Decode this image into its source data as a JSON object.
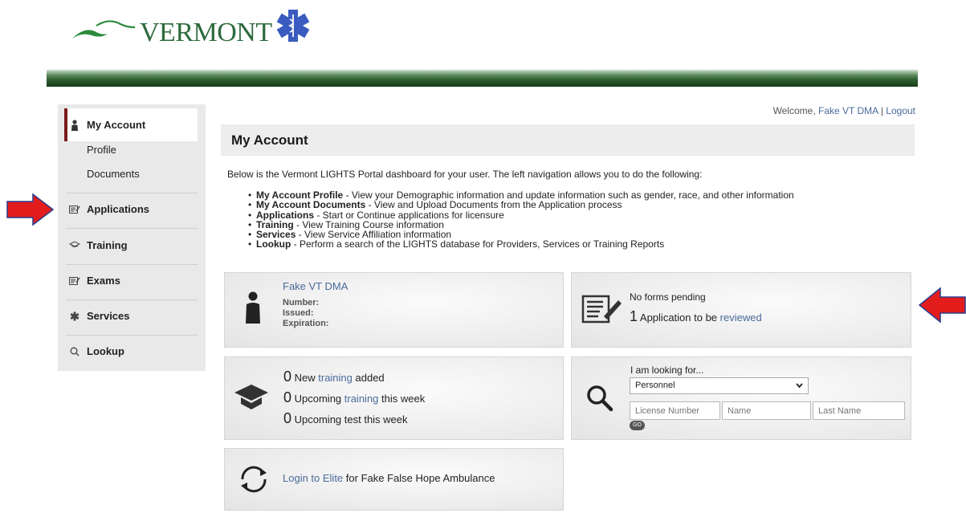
{
  "header": {
    "logo_text": "VERMONT"
  },
  "welcome": {
    "prefix": "Welcome, ",
    "user": "Fake VT DMA",
    "sep": " | ",
    "logout": "Logout"
  },
  "sidebar": {
    "items": [
      {
        "label": "My Account",
        "icon": "person-icon"
      },
      {
        "label": "Profile"
      },
      {
        "label": "Documents"
      },
      {
        "label": "Applications",
        "icon": "form-icon"
      },
      {
        "label": "Training",
        "icon": "grad-cap-icon"
      },
      {
        "label": "Exams",
        "icon": "form-icon"
      },
      {
        "label": "Services",
        "icon": "star-of-life-icon"
      },
      {
        "label": "Lookup",
        "icon": "search-icon"
      }
    ]
  },
  "main": {
    "title": "My Account",
    "intro": "Below is the Vermont LIGHTS Portal dashboard for your user. The left navigation allows you to do the following:",
    "bullets": [
      {
        "bold": "My Account Profile",
        "text": " - View your Demographic information and update information such as gender, race, and other information"
      },
      {
        "bold": "My Account Documents",
        "text": " - View and Upload Documents from the Application process"
      },
      {
        "bold": "Applications",
        "text": " - Start or Continue applications for licensure"
      },
      {
        "bold": "Training",
        "text": " - View Training Course information"
      },
      {
        "bold": "Services",
        "text": " - View Service Affiliation information"
      },
      {
        "bold": "Lookup",
        "text": " - Perform a search of the LIGHTS database for Providers, Services or Training Reports"
      }
    ]
  },
  "profile_card": {
    "name": "Fake VT DMA",
    "number_label": "Number:",
    "issued_label": "Issued:",
    "expiration_label": "Expiration:"
  },
  "forms_card": {
    "no_forms": "No forms pending",
    "count": "1",
    "app_text": " Application to be ",
    "app_link": "reviewed"
  },
  "training_card": {
    "rows": [
      {
        "count": "0",
        "pre": " New ",
        "link": "training",
        "post": " added"
      },
      {
        "count": "0",
        "pre": " Upcoming ",
        "link": "training",
        "post": " this week"
      },
      {
        "count": "0",
        "pre": " Upcoming test this week",
        "link": "",
        "post": ""
      }
    ]
  },
  "lookup_card": {
    "label": "I am looking for...",
    "selected": "Personnel",
    "license_placeholder": "License Number",
    "name_placeholder": "Name",
    "lastname_placeholder": "Last Name",
    "go": "GO"
  },
  "elite_card": {
    "link": "Login to Elite",
    "text": " for Fake False Hope Ambulance"
  },
  "colors": {
    "accent_red": "#e31c1c",
    "link": "#4a6a9a",
    "banner_green": "#2f5e31"
  }
}
